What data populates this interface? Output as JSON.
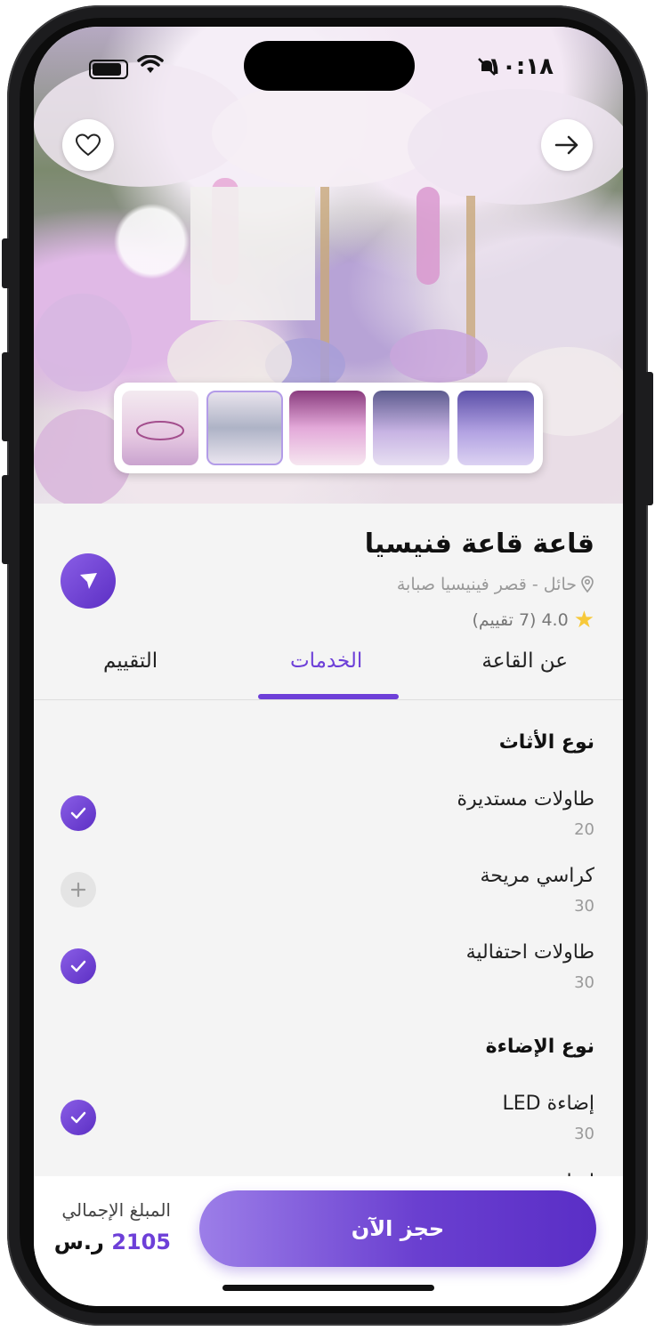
{
  "status_bar": {
    "time": "١٠:١٨"
  },
  "hall": {
    "title": "قاعة قاعة فنيسيا",
    "location": "حائل - قصر فينيسيا صبابة",
    "rating_value": "4.0",
    "rating_count": "(7 تقييم)"
  },
  "thumbnails": [
    "صورة 1",
    "صورة 2",
    "صورة 3",
    "صورة 4",
    "صورة 5"
  ],
  "tabs": [
    {
      "label": "عن القاعة",
      "active": false
    },
    {
      "label": "الخدمات",
      "active": true
    },
    {
      "label": "التقييم",
      "active": false
    }
  ],
  "services": [
    {
      "section": "نوع الأثاث",
      "items": [
        {
          "name": "طاولات مستديرة",
          "qty": "20",
          "selected": true
        },
        {
          "name": "كراسي مريحة",
          "qty": "30",
          "selected": false
        },
        {
          "name": "طاولات احتفالية",
          "qty": "30",
          "selected": true
        }
      ]
    },
    {
      "section": "نوع الإضاءة",
      "items": [
        {
          "name": "إضاءة LED",
          "qty": "30",
          "selected": true
        },
        {
          "name": "إضاءة",
          "qty": "",
          "selected": false
        }
      ]
    }
  ],
  "footer": {
    "total_label": "المبلغ الإجمالي",
    "total_amount": "2105",
    "currency": "ر.س",
    "book_label": "حجز الآن"
  },
  "colors": {
    "accent": "#6d3fd8",
    "star": "#f7c93a"
  },
  "icons": [
    "heart-icon",
    "arrow-right-icon",
    "location-pin-icon",
    "star-icon",
    "navigation-icon",
    "check-icon",
    "plus-icon",
    "wifi-icon",
    "battery-icon",
    "bell-off-icon"
  ]
}
